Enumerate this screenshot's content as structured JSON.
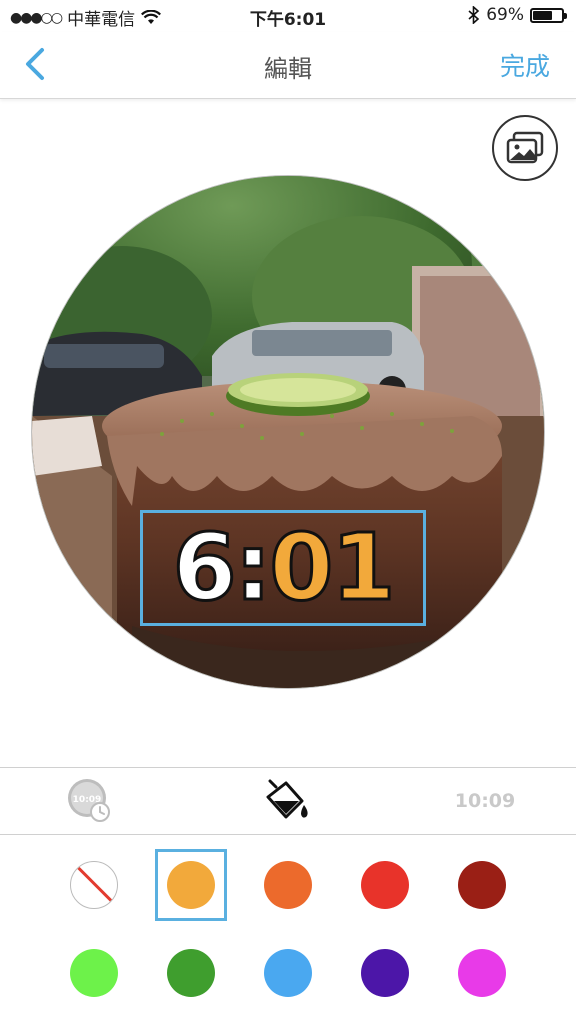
{
  "status_bar": {
    "signal": "●●●○○",
    "carrier": "中華電信",
    "time": "下午6:01",
    "battery_text": "69%",
    "battery_level": 0.69
  },
  "nav": {
    "title": "編輯",
    "done_label": "完成"
  },
  "clock_overlay": {
    "hours": "6:",
    "minutes": "01"
  },
  "toolbar": {
    "clock_icon_text": "10:09",
    "text_style_label": "10:09"
  },
  "palette": {
    "selected_index": 1,
    "colors": [
      {
        "name": "none",
        "hex": "#ffffff"
      },
      {
        "name": "orange-yellow",
        "hex": "#f2a93b"
      },
      {
        "name": "orange",
        "hex": "#ec6a2c"
      },
      {
        "name": "red",
        "hex": "#e8332a"
      },
      {
        "name": "dark-red",
        "hex": "#9a1f15"
      },
      {
        "name": "light-green",
        "hex": "#6df24a"
      },
      {
        "name": "green",
        "hex": "#3f9e2e"
      },
      {
        "name": "light-blue",
        "hex": "#4aa8f0"
      },
      {
        "name": "purple",
        "hex": "#4c16a8"
      },
      {
        "name": "magenta",
        "hex": "#e83ae8"
      }
    ]
  },
  "accent_color": "#4aa8e0"
}
